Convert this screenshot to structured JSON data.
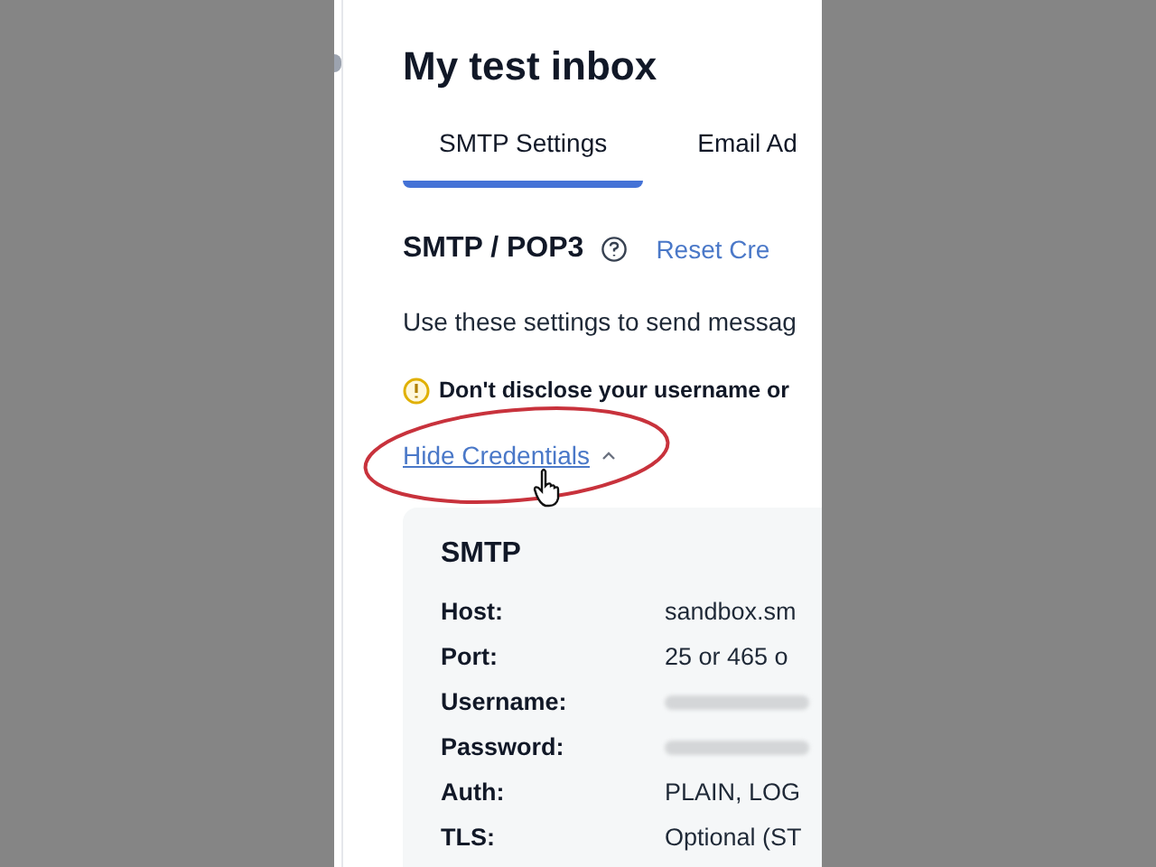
{
  "page": {
    "title": "My test inbox"
  },
  "tabs": [
    {
      "label": "SMTP Settings",
      "selected": true
    },
    {
      "label": "Email Ad",
      "selected": false
    }
  ],
  "section": {
    "heading": "SMTP / POP3",
    "link": "Reset Cre"
  },
  "intro": "Use these settings to send messag",
  "warning": "Don't disclose your username or",
  "toggle": {
    "label": "Hide Credentials",
    "expanded": true
  },
  "credentials": {
    "heading": "SMTP",
    "rows": [
      {
        "label": "Host:",
        "kind": "text",
        "value": "sandbox.sm"
      },
      {
        "label": "Port:",
        "kind": "text",
        "value": "25 or 465 o"
      },
      {
        "label": "Username:",
        "kind": "hidden"
      },
      {
        "label": "Password:",
        "kind": "hidden"
      },
      {
        "label": "Auth:",
        "kind": "text",
        "value": "PLAIN, LOG"
      },
      {
        "label": "TLS:",
        "kind": "text",
        "value": "Optional (ST"
      }
    ]
  }
}
